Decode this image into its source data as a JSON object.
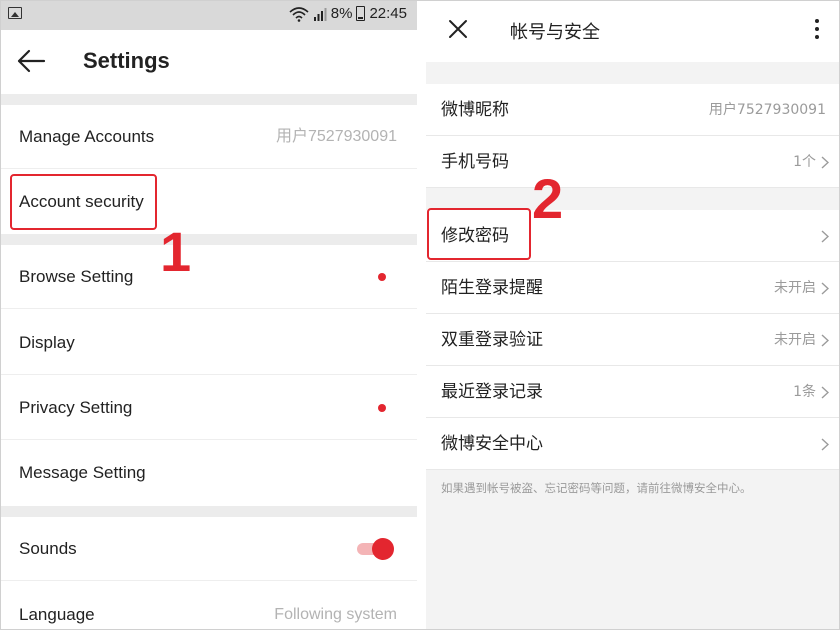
{
  "status_bar": {
    "battery_text": "8%",
    "time": "22:45"
  },
  "left": {
    "back_icon": "arrow-left-icon",
    "title": "Settings",
    "rows": [
      {
        "label": "Manage Accounts",
        "value": "用户7527930091"
      },
      {
        "label": "Account security",
        "value": ""
      },
      {
        "label": "Browse Setting",
        "value": "",
        "dot": true
      },
      {
        "label": "Display",
        "value": ""
      },
      {
        "label": "Privacy Setting",
        "value": "",
        "dot": true
      },
      {
        "label": "Message Setting",
        "value": ""
      },
      {
        "label": "Sounds",
        "value": "",
        "toggle": true
      },
      {
        "label": "Language",
        "value": "Following system"
      }
    ],
    "step_label": "1"
  },
  "right": {
    "close_icon": "close-icon",
    "title": "帐号与安全",
    "more_icon": "more-vertical-icon",
    "rows": [
      {
        "label": "微博昵称",
        "value": ""
      },
      {
        "label": "手机号码",
        "value": "1个"
      },
      {
        "label": "修改密码",
        "value": ""
      },
      {
        "label": "陌生登录提醒",
        "value": "未开启"
      },
      {
        "label": "双重登录验证",
        "value": "未开启"
      },
      {
        "label": "最近登录记录",
        "value": "1条"
      },
      {
        "label": "微博安全中心",
        "value": ""
      }
    ],
    "nickname_value": "用户7527930091",
    "note": "如果遇到帐号被盗、忘记密码等问题，请前往微博安全中心。",
    "step_label": "2"
  },
  "colors": {
    "accent": "#e3262f",
    "status_bar_bg": "#d9d9d9",
    "panel_bg": "#f3f3f3"
  }
}
